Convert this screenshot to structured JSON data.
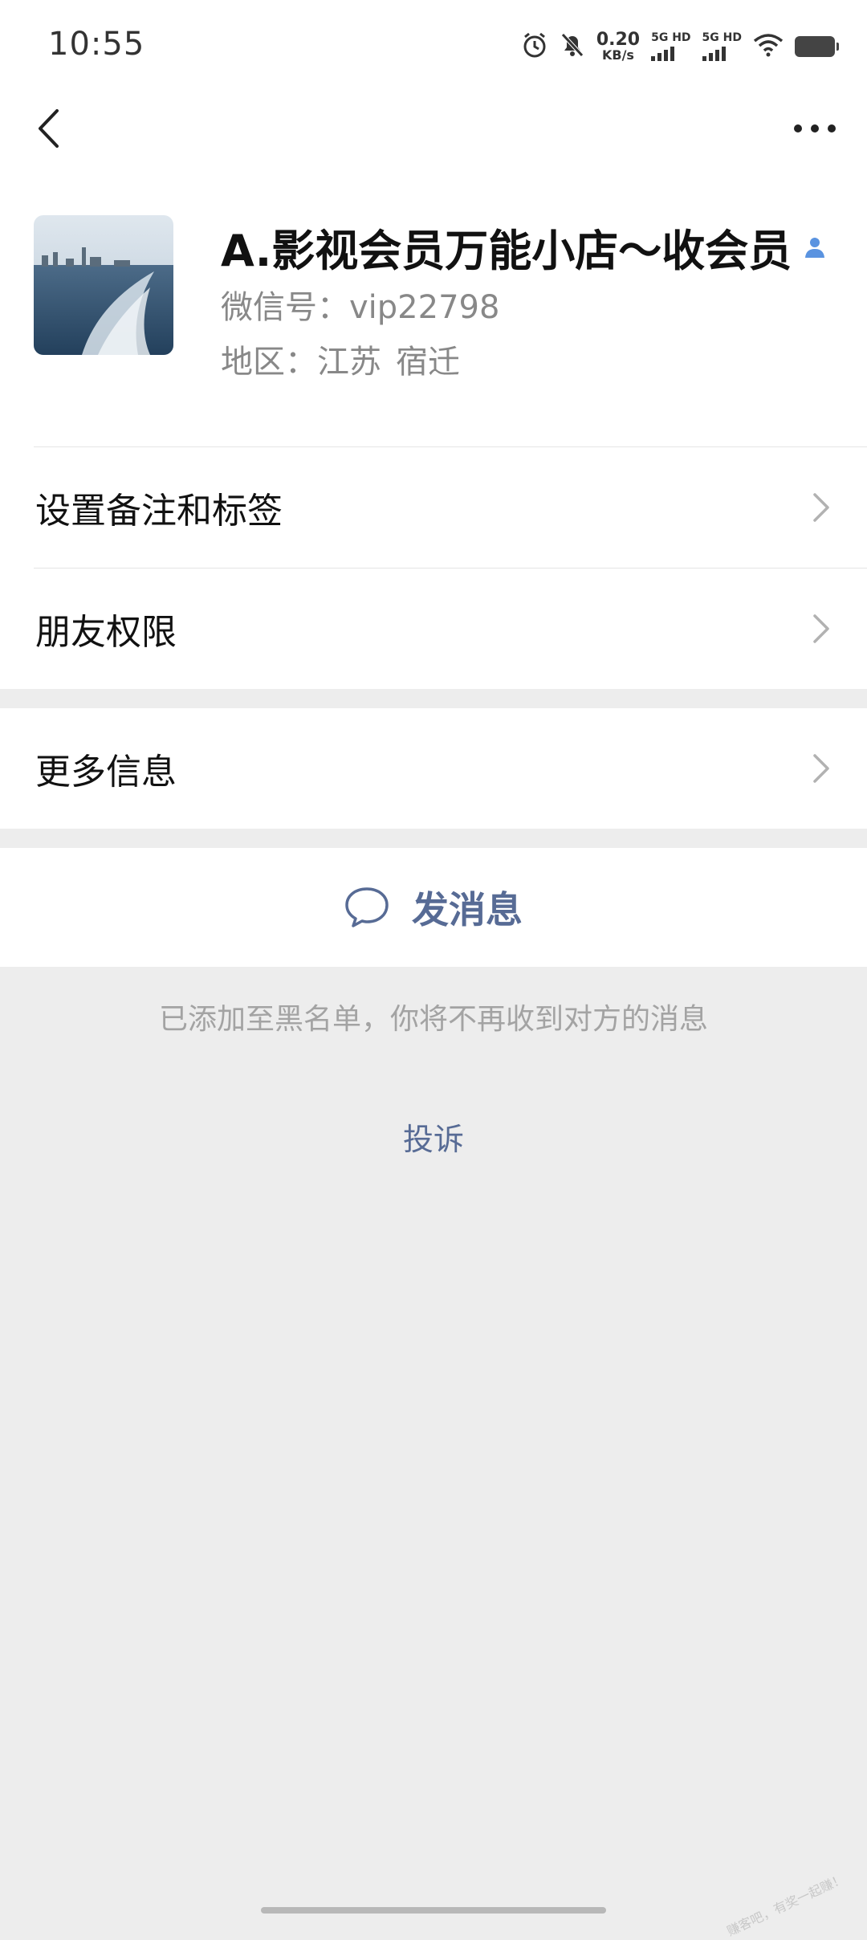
{
  "status_bar": {
    "time": "10:55",
    "net_speed_value": "0.20",
    "net_speed_unit": "KB/s",
    "sim1_label": "5G HD",
    "sim2_label": "5G HD"
  },
  "profile": {
    "name": "A.影视会员万能小店～收会员",
    "wechat_id": "微信号：vip22798",
    "region_label": "地区：江苏",
    "region_city": "宿迁"
  },
  "menu": {
    "items": [
      {
        "label": "设置备注和标签"
      },
      {
        "label": "朋友权限"
      },
      {
        "label": "更多信息"
      }
    ]
  },
  "actions": {
    "send_message": "发消息"
  },
  "notice": {
    "blacklist": "已添加至黑名单，你将不再收到对方的消息",
    "complain": "投诉"
  },
  "watermark": "赚客吧，有奖一起赚！",
  "colors": {
    "link": "#576b95",
    "background": "#ededed"
  }
}
